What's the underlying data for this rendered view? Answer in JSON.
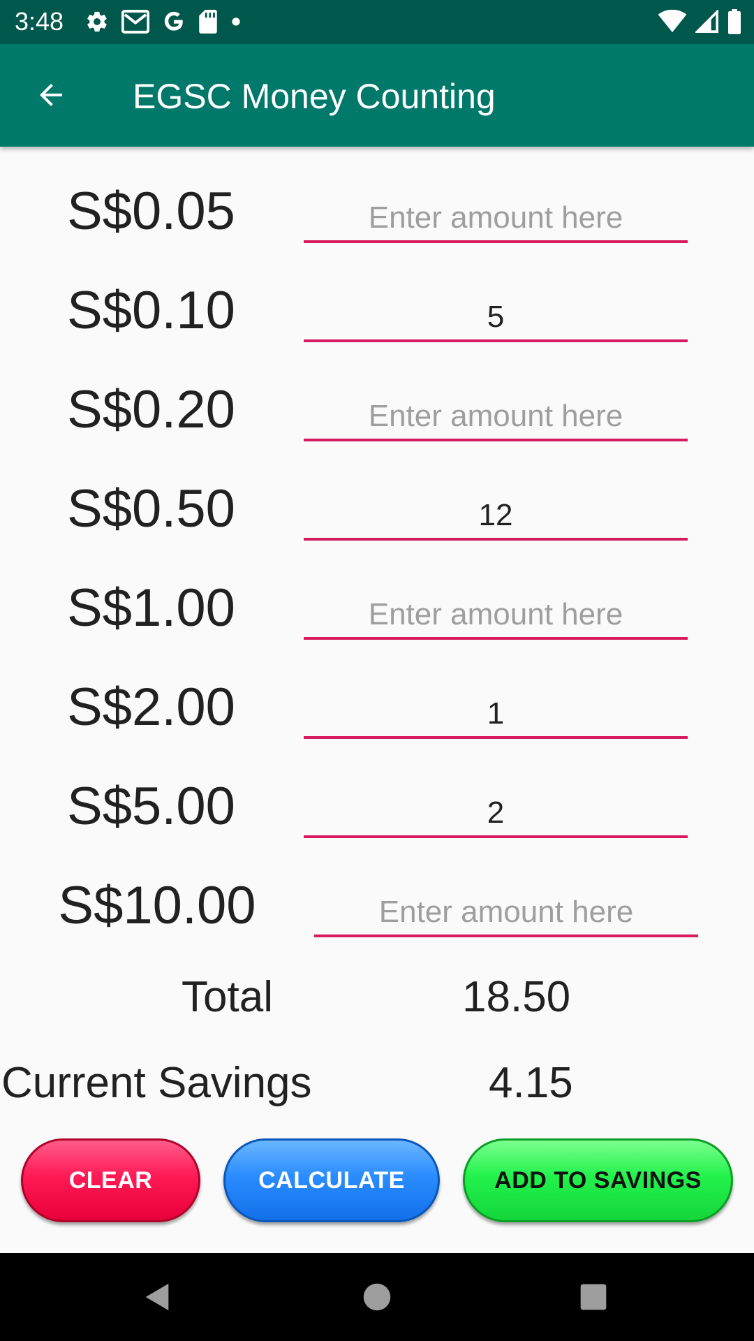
{
  "status_bar": {
    "time": "3:48",
    "left_icons": [
      "settings-icon",
      "gmail-icon",
      "google-icon",
      "sd-card-icon",
      "dot-icon"
    ],
    "right_icons": [
      "wifi-icon",
      "signal-icon",
      "battery-icon"
    ]
  },
  "app_bar": {
    "title": "EGSC Money Counting",
    "back_icon": "arrow-back-icon",
    "background": "#00796b",
    "status_background": "#00574b"
  },
  "denominations": [
    {
      "label": "S$0.05",
      "value": "",
      "placeholder": "Enter amount here"
    },
    {
      "label": "S$0.10",
      "value": "5",
      "placeholder": "Enter amount here"
    },
    {
      "label": "S$0.20",
      "value": "",
      "placeholder": "Enter amount here"
    },
    {
      "label": "S$0.50",
      "value": "12",
      "placeholder": "Enter amount here"
    },
    {
      "label": "S$1.00",
      "value": "",
      "placeholder": "Enter amount here"
    },
    {
      "label": "S$2.00",
      "value": "1",
      "placeholder": "Enter amount here"
    },
    {
      "label": "S$5.00",
      "value": "2",
      "placeholder": "Enter amount here"
    },
    {
      "label": "S$10.00",
      "value": "",
      "placeholder": "Enter amount here"
    }
  ],
  "summary": {
    "total_label": "Total",
    "total_value": "18.50",
    "savings_label": "Current Savings",
    "savings_value": "4.15"
  },
  "buttons": {
    "clear": "CLEAR",
    "calculate": "CALCULATE",
    "add_to_savings": "ADD TO SAVINGS"
  },
  "colors": {
    "field_underline": "#d81b60",
    "clear": "#ff1a55",
    "calculate": "#2a8cff",
    "add_to_savings": "#22f24c"
  },
  "nav_bar": {
    "icons": [
      "back-triangle-icon",
      "home-circle-icon",
      "recents-square-icon"
    ]
  }
}
